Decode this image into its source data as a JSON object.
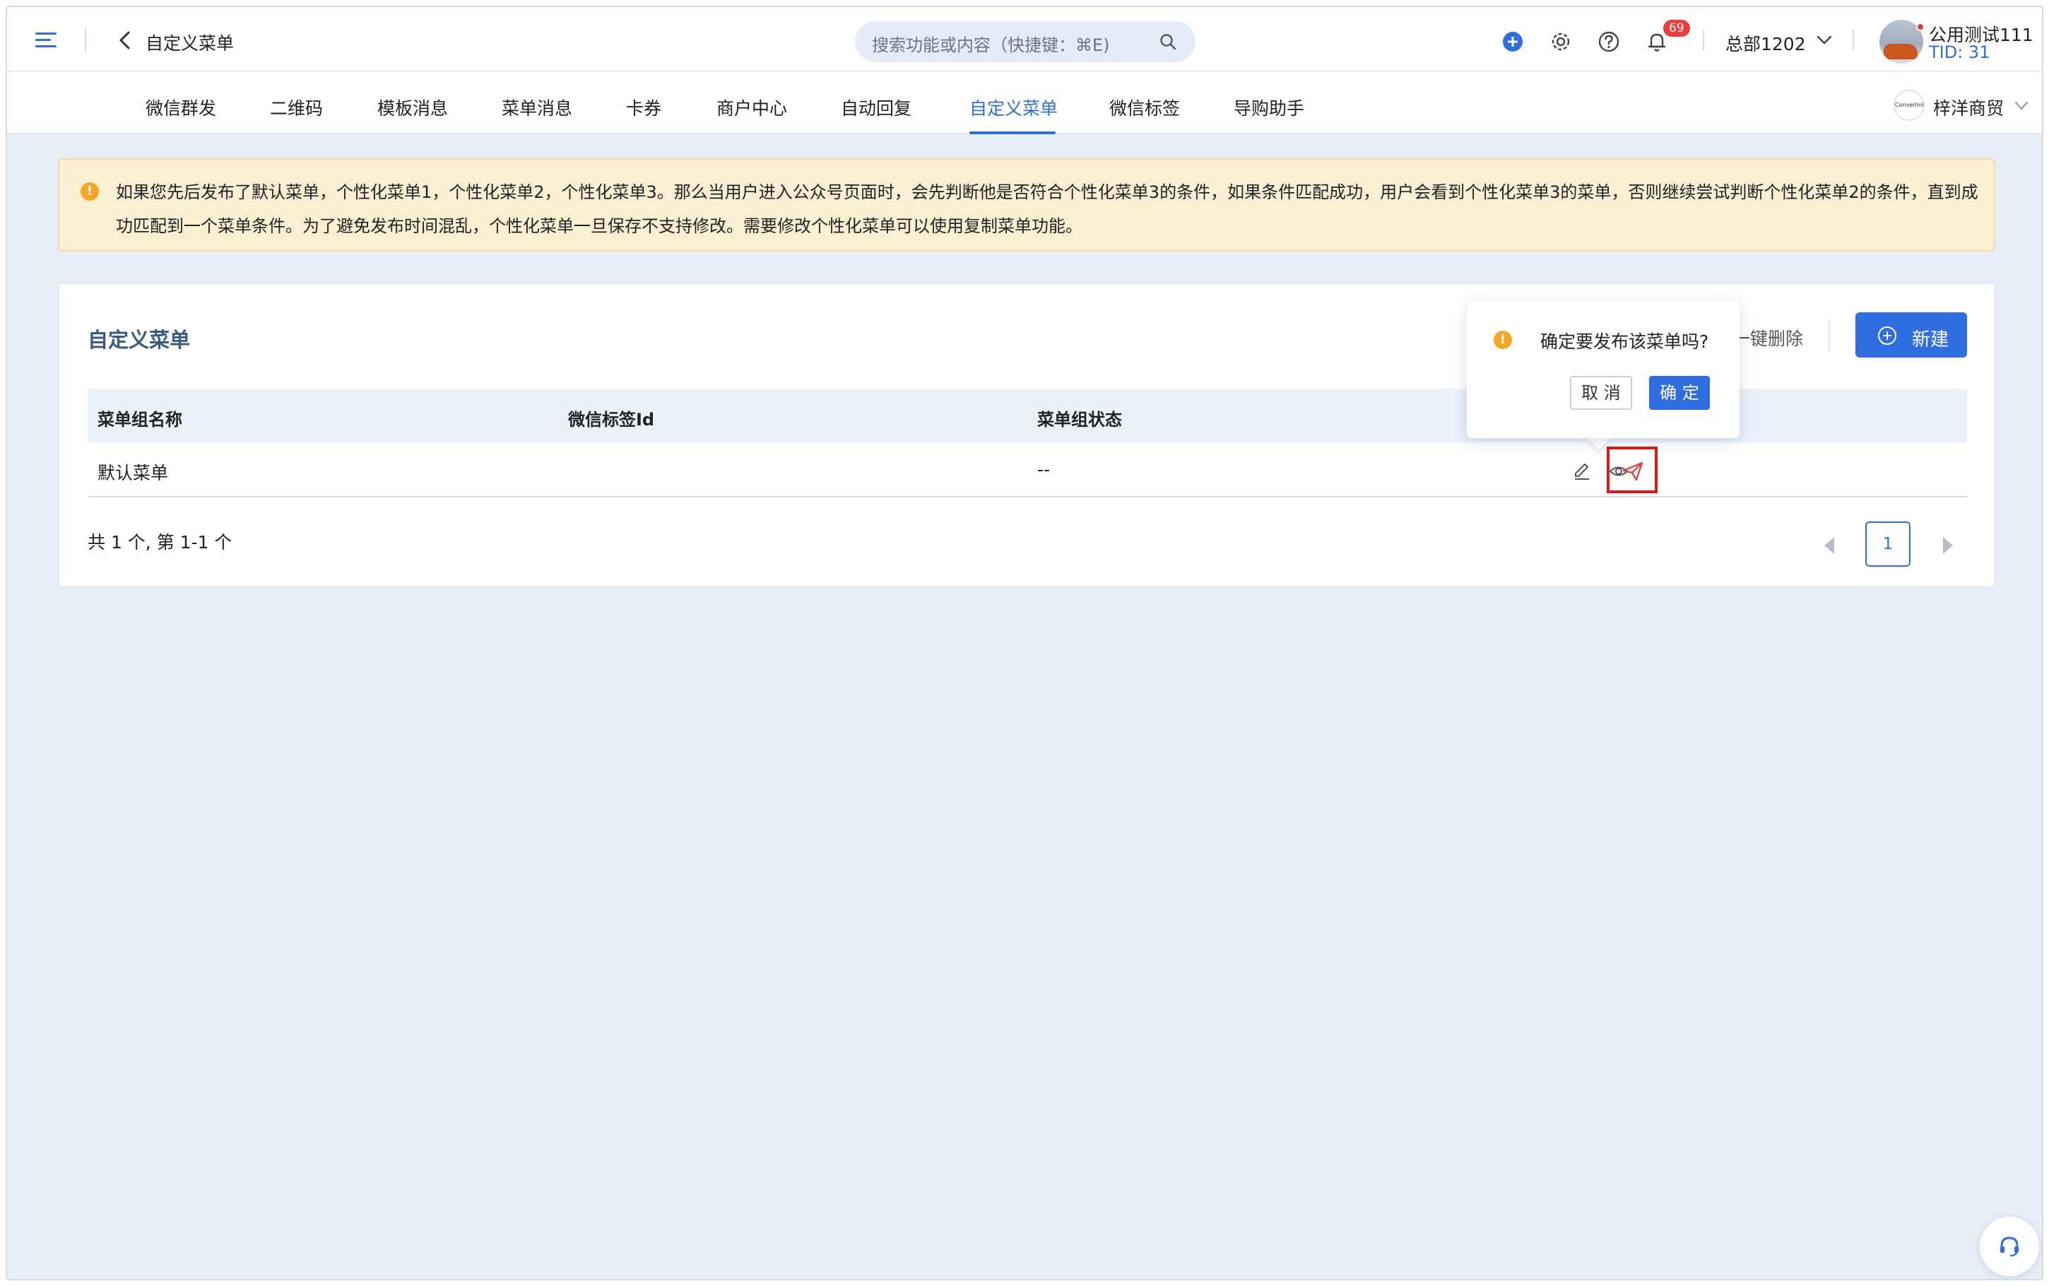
{
  "header": {
    "page_title": "自定义菜单",
    "search_placeholder": "搜索功能或内容（快捷键：⌘E)",
    "notification_count": "69",
    "department": "总部1202",
    "user_name": "公用测试111",
    "user_tid": "TID: 31"
  },
  "tabs": [
    {
      "label": "微信群发"
    },
    {
      "label": "二维码"
    },
    {
      "label": "模板消息"
    },
    {
      "label": "菜单消息"
    },
    {
      "label": "卡券"
    },
    {
      "label": "商户中心"
    },
    {
      "label": "自动回复"
    },
    {
      "label": "自定义菜单",
      "active": true
    },
    {
      "label": "微信标签"
    },
    {
      "label": "导购助手"
    }
  ],
  "brand": {
    "logo_text": "Converlink",
    "name": "梓洋商贸"
  },
  "alert": {
    "text": "如果您先后发布了默认菜单，个性化菜单1，个性化菜单2，个性化菜单3。那么当用户进入公众号页面时，会先判断他是否符合个性化菜单3的条件，如果条件匹配成功，用户会看到个性化菜单3的菜单，否则继续尝试判断个性化菜单2的条件，直到成功匹配到一个菜单条件。为了避免发布时间混乱，个性化菜单一旦保存不支持修改。需要修改个性化菜单可以使用复制菜单功能。"
  },
  "card": {
    "title": "自定义菜单",
    "bulk_delete": "一键删除",
    "new_button": "新建"
  },
  "table": {
    "columns": [
      "菜单组名称",
      "微信标签Id",
      "菜单组状态"
    ],
    "rows": [
      {
        "name": "默认菜单",
        "tag_id": "",
        "status": "--"
      }
    ]
  },
  "pagination": {
    "summary": "共 1 个, 第 1-1 个",
    "current_page": "1"
  },
  "popconfirm": {
    "message": "确定要发布该菜单吗?",
    "cancel": "取 消",
    "ok": "确 定"
  },
  "colors": {
    "accent": "#2f6ee0",
    "warning": "#f5a623",
    "highlight": "#e01818"
  }
}
